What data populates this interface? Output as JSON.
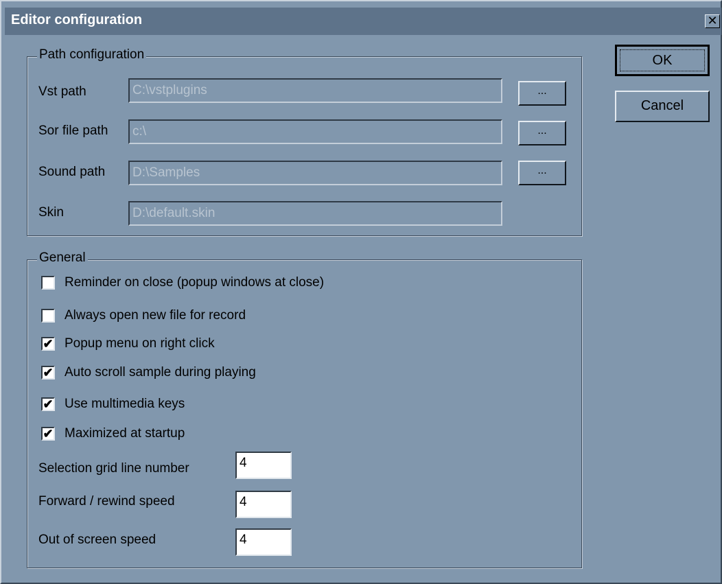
{
  "window": {
    "title": "Editor configuration",
    "close_glyph": "✕"
  },
  "path_group": {
    "legend": "Path configuration",
    "rows": [
      {
        "label": "Vst path",
        "value": "C:\\vstplugins",
        "browse": "..."
      },
      {
        "label": "Sor file path",
        "value": "c:\\",
        "browse": "..."
      },
      {
        "label": "Sound path",
        "value": "D:\\Samples",
        "browse": "..."
      },
      {
        "label": "Skin",
        "value": "D:\\default.skin"
      }
    ]
  },
  "general_group": {
    "legend": "General",
    "checkboxes": [
      {
        "label": "Reminder on close (popup windows at close)",
        "checked": false
      },
      {
        "label": "Always open new file for record",
        "checked": false
      },
      {
        "label": "Popup menu on right click",
        "checked": true
      },
      {
        "label": "Auto scroll sample during playing",
        "checked": true
      },
      {
        "label": "Use multimedia keys",
        "checked": true
      },
      {
        "label": "Maximized at startup",
        "checked": true
      }
    ],
    "fields": [
      {
        "label": "Selection grid line number",
        "value": "4"
      },
      {
        "label": "Forward / rewind speed",
        "value": "4"
      },
      {
        "label": "Out of screen speed",
        "value": "4"
      }
    ]
  },
  "buttons": {
    "ok": "OK",
    "cancel": "Cancel"
  },
  "colors": {
    "dialog_bg": "#8197ad",
    "titlebar": "#5e738a",
    "title_text": "#ffffff",
    "disabled_text": "#b8c4d0"
  },
  "icons": {
    "close": "close-icon",
    "check": "check-icon"
  }
}
